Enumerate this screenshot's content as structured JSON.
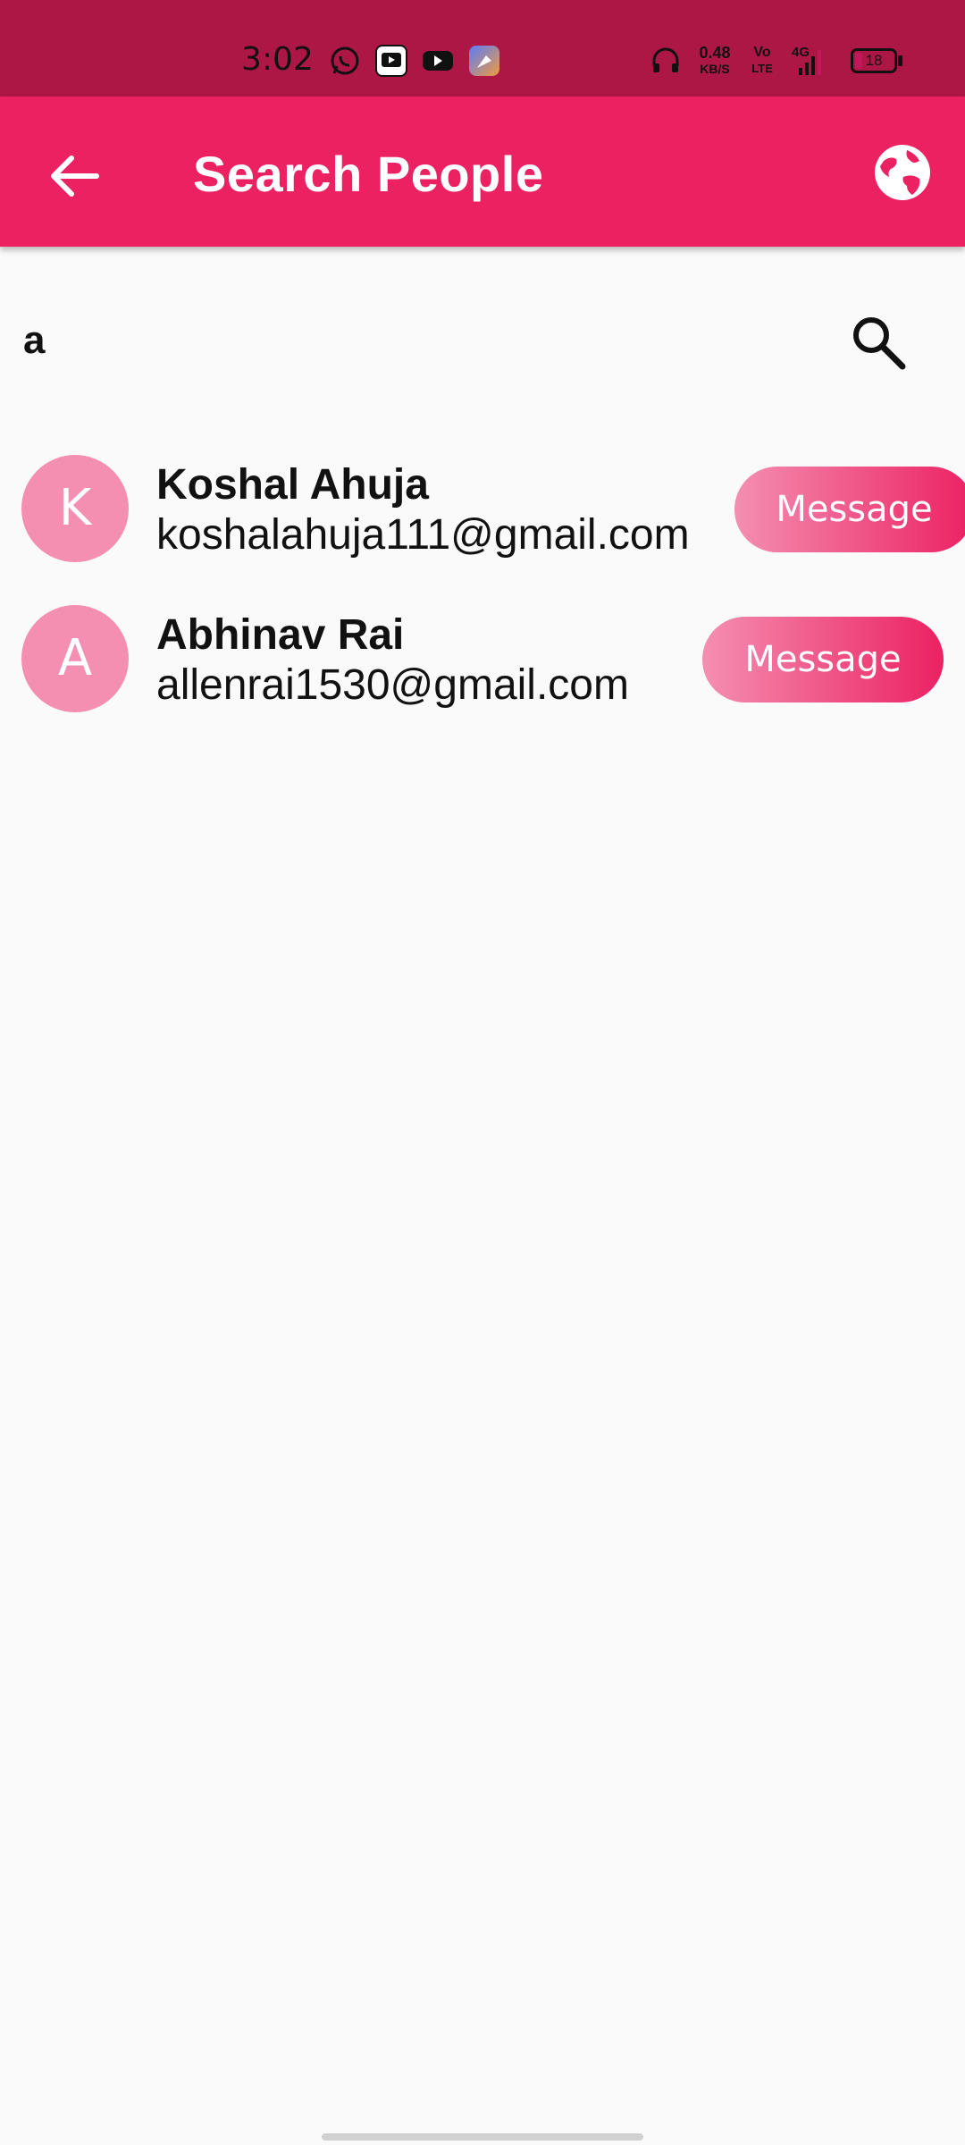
{
  "status_bar": {
    "time": "3:02",
    "net_speed": "0.48",
    "net_unit": "KB/S",
    "volte_top": "Vo",
    "volte_bottom": "LTE",
    "network": "4G",
    "battery": "18",
    "icons": [
      "whatsapp-icon",
      "youtube-studio-icon",
      "youtube-icon",
      "app-icon",
      "headphones-icon",
      "signal-icon",
      "battery-icon"
    ]
  },
  "app_bar": {
    "title": "Search People",
    "back_icon": "arrow-back-icon",
    "globe_icon": "globe-icon",
    "color": "#ec2162"
  },
  "search": {
    "value": "a",
    "search_icon": "search-icon"
  },
  "results": [
    {
      "initial": "K",
      "name": "Koshal Ahuja",
      "email": "koshalahuja111@gmail.com",
      "button": "Message"
    },
    {
      "initial": "A",
      "name": "Abhinav Rai",
      "email": "allenrai1530@gmail.com",
      "button": "Message"
    }
  ],
  "colors": {
    "status_bar": "#ad1746",
    "accent": "#ec2162",
    "avatar": "#f48fb1"
  }
}
